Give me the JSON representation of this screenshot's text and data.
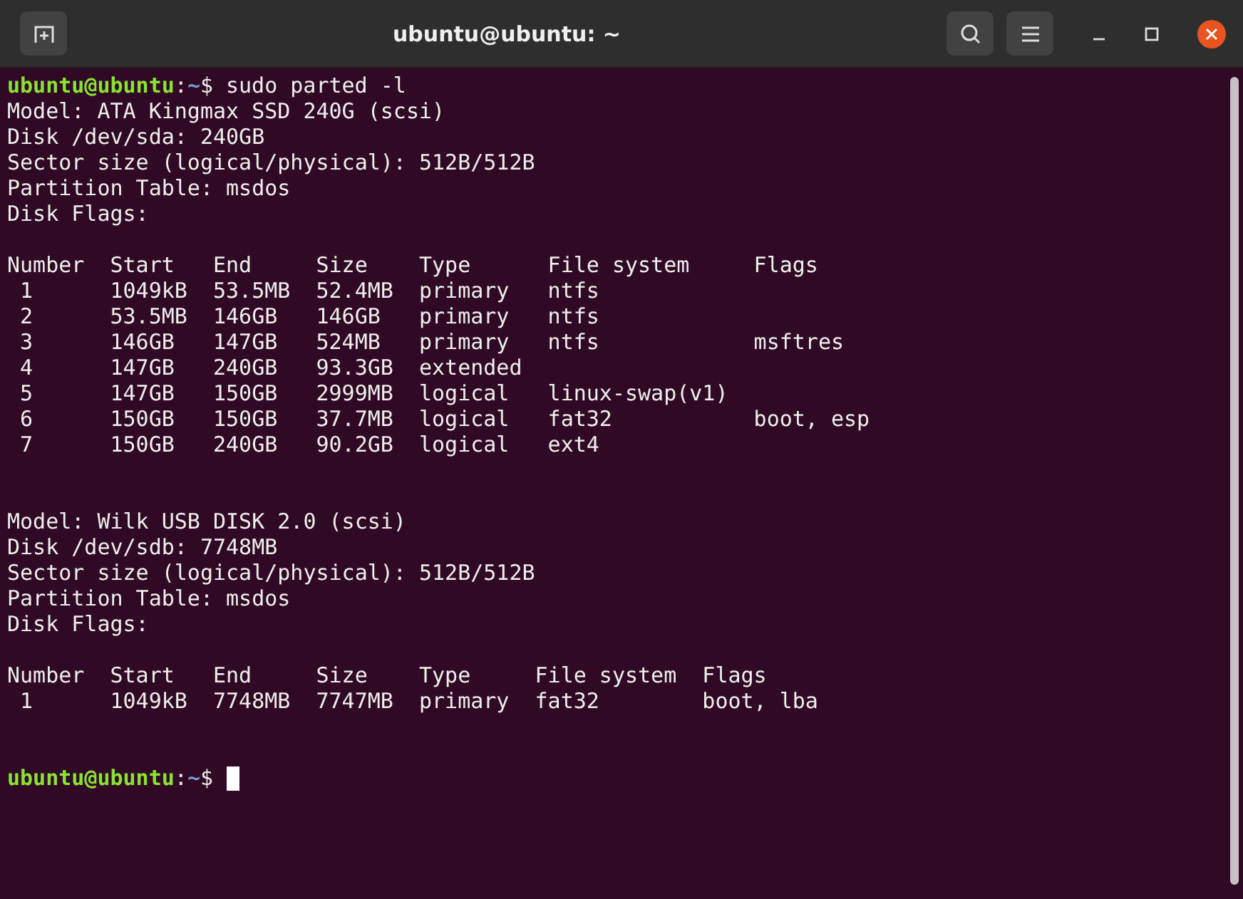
{
  "window": {
    "title": "ubuntu@ubuntu: ~"
  },
  "terminal": {
    "lines": [
      {
        "kind": "prompt",
        "user": "ubuntu@ubuntu",
        "separator": ":",
        "path": "~",
        "symbol": "$",
        "command": "sudo parted -l"
      },
      {
        "kind": "output",
        "text": "Model: ATA Kingmax SSD 240G (scsi)"
      },
      {
        "kind": "output",
        "text": "Disk /dev/sda: 240GB"
      },
      {
        "kind": "output",
        "text": "Sector size (logical/physical): 512B/512B"
      },
      {
        "kind": "output",
        "text": "Partition Table: msdos"
      },
      {
        "kind": "output",
        "text": "Disk Flags:"
      },
      {
        "kind": "blank"
      },
      {
        "kind": "output",
        "text": "Number  Start   End     Size    Type      File system     Flags"
      },
      {
        "kind": "output",
        "text": " 1      1049kB  53.5MB  52.4MB  primary   ntfs"
      },
      {
        "kind": "output",
        "text": " 2      53.5MB  146GB   146GB   primary   ntfs"
      },
      {
        "kind": "output",
        "text": " 3      146GB   147GB   524MB   primary   ntfs            msftres"
      },
      {
        "kind": "output",
        "text": " 4      147GB   240GB   93.3GB  extended"
      },
      {
        "kind": "output",
        "text": " 5      147GB   150GB   2999MB  logical   linux-swap(v1)"
      },
      {
        "kind": "output",
        "text": " 6      150GB   150GB   37.7MB  logical   fat32           boot, esp"
      },
      {
        "kind": "output",
        "text": " 7      150GB   240GB   90.2GB  logical   ext4"
      },
      {
        "kind": "blank"
      },
      {
        "kind": "blank"
      },
      {
        "kind": "output",
        "text": "Model: Wilk USB DISK 2.0 (scsi)"
      },
      {
        "kind": "output",
        "text": "Disk /dev/sdb: 7748MB"
      },
      {
        "kind": "output",
        "text": "Sector size (logical/physical): 512B/512B"
      },
      {
        "kind": "output",
        "text": "Partition Table: msdos"
      },
      {
        "kind": "output",
        "text": "Disk Flags:"
      },
      {
        "kind": "blank"
      },
      {
        "kind": "output",
        "text": "Number  Start   End     Size    Type     File system  Flags"
      },
      {
        "kind": "output",
        "text": " 1      1049kB  7748MB  7747MB  primary  fat32        boot, lba"
      },
      {
        "kind": "blank"
      },
      {
        "kind": "blank"
      },
      {
        "kind": "prompt",
        "user": "ubuntu@ubuntu",
        "separator": ":",
        "path": "~",
        "symbol": "$",
        "cursor": true
      }
    ]
  }
}
